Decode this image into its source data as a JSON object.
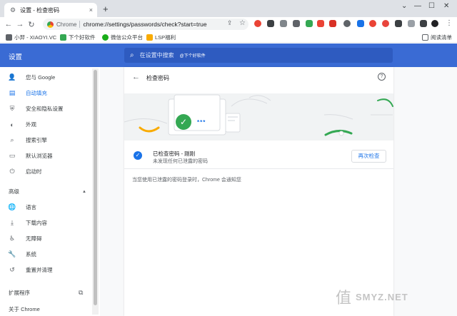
{
  "tab": {
    "title": "设置 - 检查密码",
    "close": "×"
  },
  "newtab": "+",
  "window": {
    "minimize": "—",
    "maximize": "☐",
    "close": "✕"
  },
  "omnibox": {
    "site": "Chrome",
    "url": "chrome://settings/passwords/check?start=true"
  },
  "bookmarks": [
    {
      "label": "小羿 - XIAOYI.VC",
      "color": "#5f6368"
    },
    {
      "label": "下个好软件",
      "color": "#34a853"
    },
    {
      "label": "微信公众平台",
      "color": "#1aad19"
    },
    {
      "label": "LSP福利",
      "color": "#f9ab00"
    }
  ],
  "bookmarks_right": "阅读清单",
  "header": {
    "title": "设置",
    "search_placeholder": "在设置中搜索",
    "search_hint": "@下个好软件"
  },
  "sidebar": {
    "items": [
      {
        "label": "您与 Google",
        "icon": "person-icon",
        "glyph": "👤"
      },
      {
        "label": "自动填充",
        "icon": "autofill-icon",
        "glyph": "▤",
        "active": true
      },
      {
        "label": "安全和隐私设置",
        "icon": "shield-icon",
        "glyph": "⛨"
      },
      {
        "label": "外观",
        "icon": "palette-icon",
        "glyph": "◐"
      },
      {
        "label": "搜索引擎",
        "icon": "search-icon",
        "glyph": "⌕"
      },
      {
        "label": "默认浏览器",
        "icon": "browser-icon",
        "glyph": "▭"
      },
      {
        "label": "启动时",
        "icon": "power-icon",
        "glyph": "⏻"
      }
    ],
    "advanced": "高级",
    "advanced_items": [
      {
        "label": "语言",
        "icon": "globe-icon",
        "glyph": "🌐"
      },
      {
        "label": "下载内容",
        "icon": "download-icon",
        "glyph": "⤓"
      },
      {
        "label": "无障碍",
        "icon": "accessibility-icon",
        "glyph": "♿"
      },
      {
        "label": "系统",
        "icon": "wrench-icon",
        "glyph": "🔧"
      },
      {
        "label": "重置并清理",
        "icon": "reset-icon",
        "glyph": "↺"
      }
    ],
    "extensions": "扩展程序",
    "about": "关于 Chrome"
  },
  "page": {
    "title": "检查密码",
    "banner_mask": "***",
    "status_title": "已检查密码 - 刚刚",
    "status_sub": "未发现任何已泄露的密码",
    "recheck": "再次检查",
    "note": "当您使用已泄露的密码登录时，Chrome 会通知您"
  },
  "watermark": {
    "glyph": "值",
    "brand": "SMYZ.NET"
  },
  "colors": {
    "accent": "#1a73e8",
    "header": "#3a6bd4"
  }
}
